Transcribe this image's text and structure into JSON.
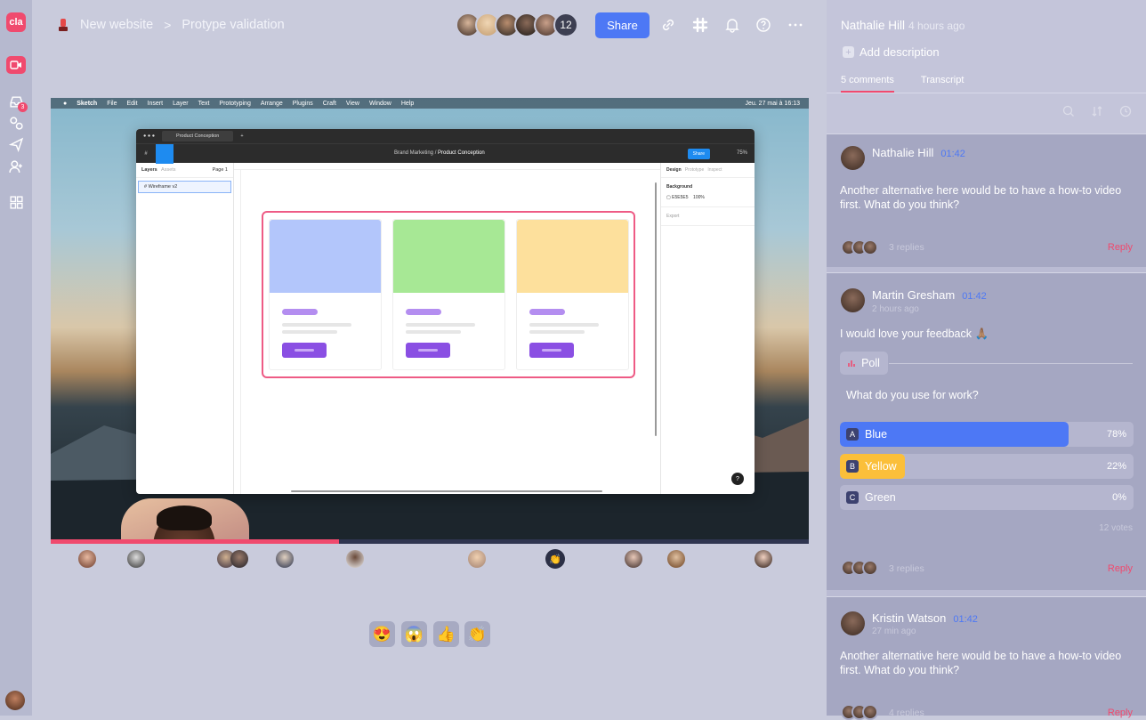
{
  "rail": {
    "logo_text": "cla",
    "inbox_badge": "3"
  },
  "header": {
    "project": "New website",
    "separator": ">",
    "page": "Protype validation",
    "avatar_count": "12",
    "share_label": "Share"
  },
  "video": {
    "mac_menu": [
      "Sketch",
      "File",
      "Edit",
      "Insert",
      "Layer",
      "Text",
      "Prototyping",
      "Arrange",
      "Plugins",
      "Craft",
      "View",
      "Window",
      "Help"
    ],
    "mac_clock": "Jeu. 27 mai à 16:13",
    "figma": {
      "tab": "Product Conception",
      "path_parent": "Brand Marketing",
      "path_current": "Product Conception",
      "share": "Share",
      "zoom": "75%",
      "layers_label": "Layers",
      "assets_label": "Assets",
      "page_label": "Page 1",
      "layer_item": "Wireframe v2",
      "design_tab": "Design",
      "prototype_tab": "Prototype",
      "inspect_tab": "Inspect",
      "background_label": "Background",
      "bg_hex": "E5E5E5",
      "bg_opacity": "100%",
      "export_label": "Export",
      "help": "?",
      "card_colors": [
        "#b3c6fb",
        "#a7e895",
        "#fde09c"
      ]
    },
    "progress": 0.38
  },
  "reactions": [
    "😍",
    "😱",
    "👍",
    "👏"
  ],
  "panel": {
    "author": "Nathalie Hill",
    "author_ago": "4 hours ago",
    "add_description": "Add description",
    "tab_comments": "5 comments",
    "tab_transcript": "Transcript",
    "comments": [
      {
        "name": "Nathalie Hill",
        "time": "01:42",
        "ago": "",
        "text": "Another alternative here would be to have a how-to video first. What do you think?",
        "replies": "3 replies",
        "reply": "Reply"
      },
      {
        "name": "Martin Gresham",
        "time": "01:42",
        "ago": "2 hours ago",
        "text": "I would love your feedback 🙏🏽",
        "replies": "3 replies",
        "reply": "Reply"
      },
      {
        "name": "Kristin Watson",
        "time": "01:42",
        "ago": "27 min ago",
        "text": "Another alternative here would be to have a how-to video first. What do you think?",
        "replies": "4 replies",
        "reply": "Reply"
      }
    ],
    "poll": {
      "label": "Poll",
      "question": "What do you use for work?",
      "options": [
        {
          "letter": "A",
          "name": "Blue",
          "pct": "78%",
          "value": 0.78,
          "color": "#4d78f5"
        },
        {
          "letter": "B",
          "name": "Yellow",
          "pct": "22%",
          "value": 0.22,
          "color": "#fbbf3a"
        },
        {
          "letter": "C",
          "name": "Green",
          "pct": "0%",
          "value": 0,
          "color": "#6fcf6a"
        }
      ],
      "votes": "12 votes"
    }
  },
  "colors": {
    "accent": "#f04a6e",
    "primary": "#4d78f5"
  }
}
